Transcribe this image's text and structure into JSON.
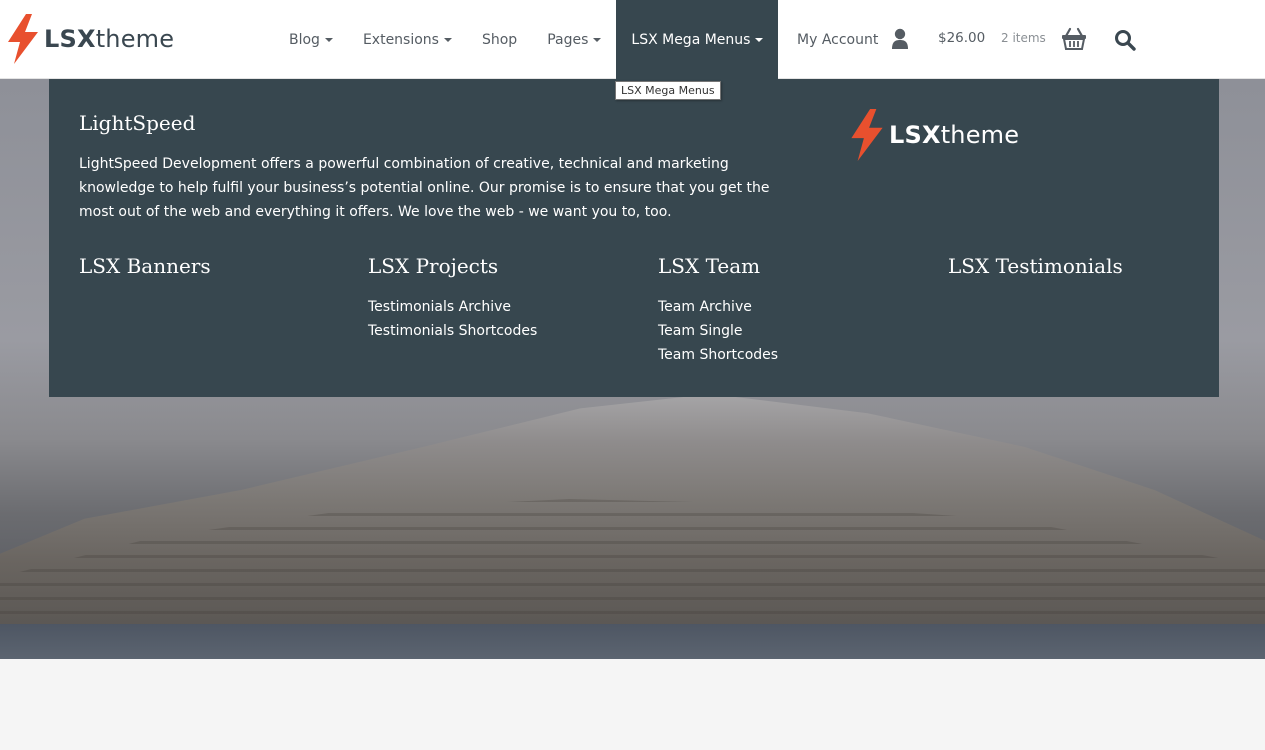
{
  "header": {
    "logo": {
      "bold": "LSX",
      "light": "theme"
    },
    "nav": [
      {
        "label": "Blog",
        "has_caret": true
      },
      {
        "label": "Extensions",
        "has_caret": true
      },
      {
        "label": "Shop",
        "has_caret": false
      },
      {
        "label": "Pages",
        "has_caret": true
      },
      {
        "label": "LSX Mega Menus",
        "has_caret": true,
        "active": true
      }
    ],
    "account_label": "My Account",
    "cart_amount": "$26.00",
    "cart_count": "2 items",
    "tooltip": "LSX Mega Menus"
  },
  "mega_menu": {
    "about_title": "LightSpeed",
    "about_text": "LightSpeed Development offers a powerful combination of creative, technical and marketing knowledge to help fulfil your business’s potential online. Our promise is to ensure that you get the most out of the web and everything it offers. We love the web - we want you to, too.",
    "logo": {
      "bold": "LSX",
      "light": "theme"
    },
    "columns": [
      {
        "title": "LSX Banners",
        "links": []
      },
      {
        "title": "LSX Projects",
        "links": [
          "Testimonials Archive",
          "Testimonials Shortcodes"
        ]
      },
      {
        "title": "LSX Team",
        "links": [
          "Team Archive",
          "Team Single",
          "Team Shortcodes"
        ]
      },
      {
        "title": "LSX Testimonials",
        "links": []
      }
    ]
  },
  "colors": {
    "brand_orange": "#e8502e",
    "mega_bg": "#37474f",
    "text_dark": "#3a4750"
  },
  "icons": [
    "lightning-logo-icon",
    "user-icon",
    "basket-icon",
    "search-icon",
    "caret-down-icon"
  ]
}
